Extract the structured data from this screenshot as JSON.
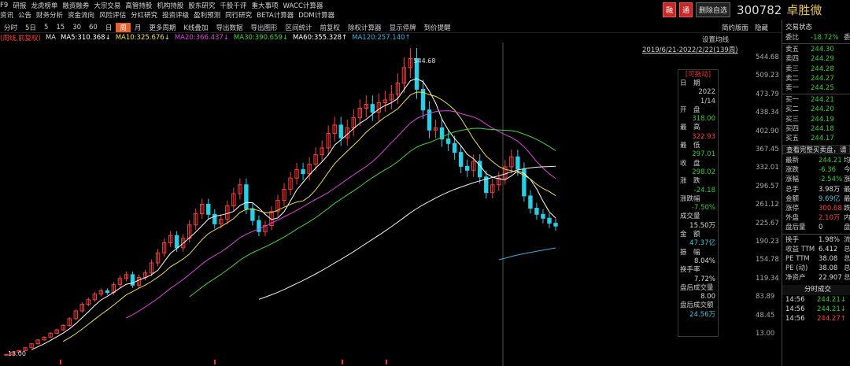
{
  "top_menu": {
    "row1": [
      "F9",
      "研报",
      "龙虎榜单",
      "融资融券",
      "大宗交易",
      "高管持股",
      "机构持股",
      "股东研究",
      "千股千评",
      "重大事项",
      "WACC计算器"
    ],
    "row2": [
      "资讯",
      "公告",
      "财务分析",
      "资金流向",
      "风险评估",
      "分红研究",
      "投资评级",
      "盈利预测",
      "同行研究",
      "BETA计算器",
      "DDM计算器"
    ]
  },
  "header": {
    "btn_rong": "融",
    "btn_tong": "通",
    "btn_delete": "删除自选",
    "code": "300782",
    "name": "卓胜微"
  },
  "toolbar": {
    "items": [
      "分时",
      "5日",
      "5",
      "15",
      "30",
      "60",
      "日",
      "周",
      "月",
      "更多周期",
      "K线叠加",
      "导出数据",
      "导出图形",
      "区间统计",
      "前复权",
      "除权计算器",
      "显示停牌",
      "到价提醒"
    ],
    "active": "周",
    "right": [
      "简约版面",
      "隐藏"
    ]
  },
  "ma_legend": {
    "mode": "(周线,前复权)",
    "ma": "MA",
    "items": [
      {
        "text": "MA5:310.368↓",
        "color": "#ffffff"
      },
      {
        "text": "MA10:325.676↓",
        "color": "#f0e040"
      },
      {
        "text": "MA20:366.437↓",
        "color": "#e040e0"
      },
      {
        "text": "MA30:390.659↓",
        "color": "#3ed63e"
      },
      {
        "text": "MA60:355.328↑",
        "color": "#ffffff"
      },
      {
        "text": "MA120:257.140↑",
        "color": "#2fb0e0"
      }
    ]
  },
  "settings": {
    "ma_label": "设置均线",
    "range": "2019/6/21-2022/2/22(139周)"
  },
  "price_axis": [
    "544.68",
    "509.23",
    "473.79",
    "438.34",
    "402.90",
    "367.45",
    "332.01",
    "296.57",
    "261.12",
    "225.67",
    "190.23",
    "154.78",
    "119.34",
    "83.89",
    "48.45",
    "13.00"
  ],
  "annot": {
    "high": "544.68",
    "low": "13.00"
  },
  "tip": {
    "title": "[可拖动]",
    "rows": [
      {
        "k": "日　期",
        "v": ""
      },
      {
        "k": "",
        "v": "2022"
      },
      {
        "k": "",
        "v": "1/14"
      },
      {
        "k": "开　盘",
        "v": "318.00",
        "c": "green"
      },
      {
        "k": "最　高",
        "v": ""
      },
      {
        "k": "",
        "v": "322.93",
        "c": "red"
      },
      {
        "k": "最　低",
        "v": "297.01",
        "c": "green"
      },
      {
        "k": "收　盘",
        "v": "298.02",
        "c": "green"
      },
      {
        "k": "涨　跌",
        "v": "-24.18",
        "c": "green"
      },
      {
        "k": "涨跌幅",
        "v": ""
      },
      {
        "k": "",
        "v": "-7.50%",
        "c": "green"
      },
      {
        "k": "成交量",
        "v": ""
      },
      {
        "k": "",
        "v": "15.50万",
        "c": "wht"
      },
      {
        "k": "金　额",
        "v": ""
      },
      {
        "k": "",
        "v": "47.37亿",
        "c": "cyan"
      },
      {
        "k": "振　幅",
        "v": ""
      },
      {
        "k": "",
        "v": "8.04%",
        "c": "wht"
      },
      {
        "k": "换手率",
        "v": ""
      },
      {
        "k": "",
        "v": "7.72%",
        "c": "wht"
      },
      {
        "k": "盘后成交量",
        "v": ""
      },
      {
        "k": "",
        "v": "8.00",
        "c": "wht"
      },
      {
        "k": "盘后成交额",
        "v": ""
      },
      {
        "k": "",
        "v": "24.56万",
        "c": "cyan"
      }
    ]
  },
  "side": {
    "title": "交易状态",
    "ratio_label": "委比",
    "ratio_val": "-18.72%",
    "ratio_tail": "委差",
    "asks": [
      {
        "label": "卖五",
        "price": "244.30"
      },
      {
        "label": "卖四",
        "price": "244.29"
      },
      {
        "label": "卖三",
        "price": "244.28"
      },
      {
        "label": "卖二",
        "price": "244.27"
      },
      {
        "label": "卖一",
        "price": "244.25"
      }
    ],
    "bids": [
      {
        "label": "买一",
        "price": "244.21"
      },
      {
        "label": "买二",
        "price": "244.20"
      },
      {
        "label": "买三",
        "price": "244.19"
      },
      {
        "label": "买四",
        "price": "244.18"
      },
      {
        "label": "买五",
        "price": "244.17"
      }
    ],
    "detail_btn": "查看完整买卖盘，请",
    "stats": [
      {
        "k": "最新",
        "v": "244.21",
        "c": "green",
        "t": "均"
      },
      {
        "k": "涨跌",
        "v": "-6.36",
        "c": "green",
        "t": "今"
      },
      {
        "k": "涨幅",
        "v": "-2.54%",
        "c": "green",
        "t": "涨"
      },
      {
        "k": "总手",
        "v": "3.98万",
        "c": "wht",
        "t": "最"
      },
      {
        "k": "金额",
        "v": "9.69亿",
        "c": "cyan",
        "t": "最"
      },
      {
        "k": "涨停",
        "v": "300.68",
        "c": "red",
        "t": "跌"
      },
      {
        "k": "外盘",
        "v": "2.10万",
        "c": "red",
        "t": "内"
      },
      {
        "k": "盘后量",
        "v": "0",
        "c": "wht",
        "t": "盘"
      }
    ],
    "stats2": [
      {
        "k": "换手",
        "v": "1.98%",
        "t": "流"
      },
      {
        "k": "收益 TTM",
        "v": "6.412",
        "t": "总"
      },
      {
        "k": "PE TTM",
        "v": "38.08",
        "t": "总"
      },
      {
        "k": "PE (动)",
        "v": "38.08",
        "t": "总"
      },
      {
        "k": "净资产",
        "v": "22.907",
        "t": "总"
      }
    ],
    "trades_title": "分时成交",
    "trades": [
      {
        "t": "14:56",
        "p": "244.21↓",
        "c": "green"
      },
      {
        "t": "14:56",
        "p": "244.21↓",
        "c": "green"
      },
      {
        "t": "14:56",
        "p": "244.27↑",
        "c": "red"
      }
    ]
  },
  "chart_data": {
    "type": "candlestick",
    "ylim": [
      13.0,
      544.68
    ],
    "x_range": "2019/6/21-2022/2/22",
    "periods": 139,
    "close_path": [
      14,
      18,
      21,
      26,
      33,
      40,
      45,
      52,
      58,
      66,
      78,
      92,
      104,
      112,
      122,
      128,
      125,
      139,
      150,
      157,
      138,
      152,
      160,
      178,
      196,
      214,
      227,
      205,
      222,
      246,
      266,
      283,
      265,
      248,
      256,
      280,
      302,
      318,
      275,
      254,
      234,
      245,
      270,
      290,
      310,
      330,
      345,
      338,
      355,
      372,
      384,
      410,
      425,
      402,
      420,
      438,
      455,
      462,
      448,
      465,
      470,
      480,
      500,
      528,
      544,
      489,
      452,
      416,
      420,
      400,
      392,
      376,
      351,
      344,
      360,
      332,
      304,
      318,
      330,
      350,
      368,
      346,
      298,
      276,
      265,
      258,
      249,
      244
    ],
    "ma_levels": {
      "MA5": 310.368,
      "MA10": 325.676,
      "MA20": 366.437,
      "MA30": 390.659,
      "MA60": 355.328,
      "MA120": 257.14
    }
  }
}
